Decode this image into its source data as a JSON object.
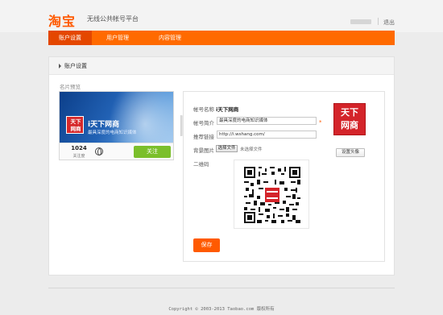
{
  "header": {
    "logo": "淘宝",
    "site_title": "无线公共帐号平台",
    "logout": "退出"
  },
  "nav": {
    "tabs": [
      {
        "label": "账户设置",
        "active": true
      },
      {
        "label": "用户管理",
        "active": false
      },
      {
        "label": "内容管理",
        "active": false
      }
    ]
  },
  "section": {
    "title": "账户设置",
    "preview_label": "名片预览"
  },
  "preview": {
    "logo_text_1": "天下",
    "logo_text_2": "网商",
    "name": "i天下网商",
    "desc": "最具深度的电商知识媒体",
    "followers_count": "1024",
    "followers_label": "关注度",
    "follow_button": "关注"
  },
  "form": {
    "account_name_label": "帐号名称",
    "account_name_value": "i天下网商",
    "intro_label": "帐号简介",
    "intro_value": "最具深度的电商知识媒体",
    "required_mark": "*",
    "link_label": "推荐链接",
    "link_value": "http://i.wshang.com/",
    "bg_label": "背景图片",
    "choose_file": "选择文件",
    "file_status": "未选择文件",
    "qr_label": "二维码",
    "save_button": "保存",
    "avatar_text_1": "天下",
    "avatar_text_2": "网商",
    "set_avatar_button": "设置头像"
  },
  "footer": {
    "copyright": "Copyright © 2003-2013 Taobao.com 版权所有"
  },
  "colors": {
    "brand_orange": "#ff6a00",
    "active_tab": "#e44700",
    "follow_green": "#7bbf2b",
    "logo_red": "#d4242a"
  }
}
